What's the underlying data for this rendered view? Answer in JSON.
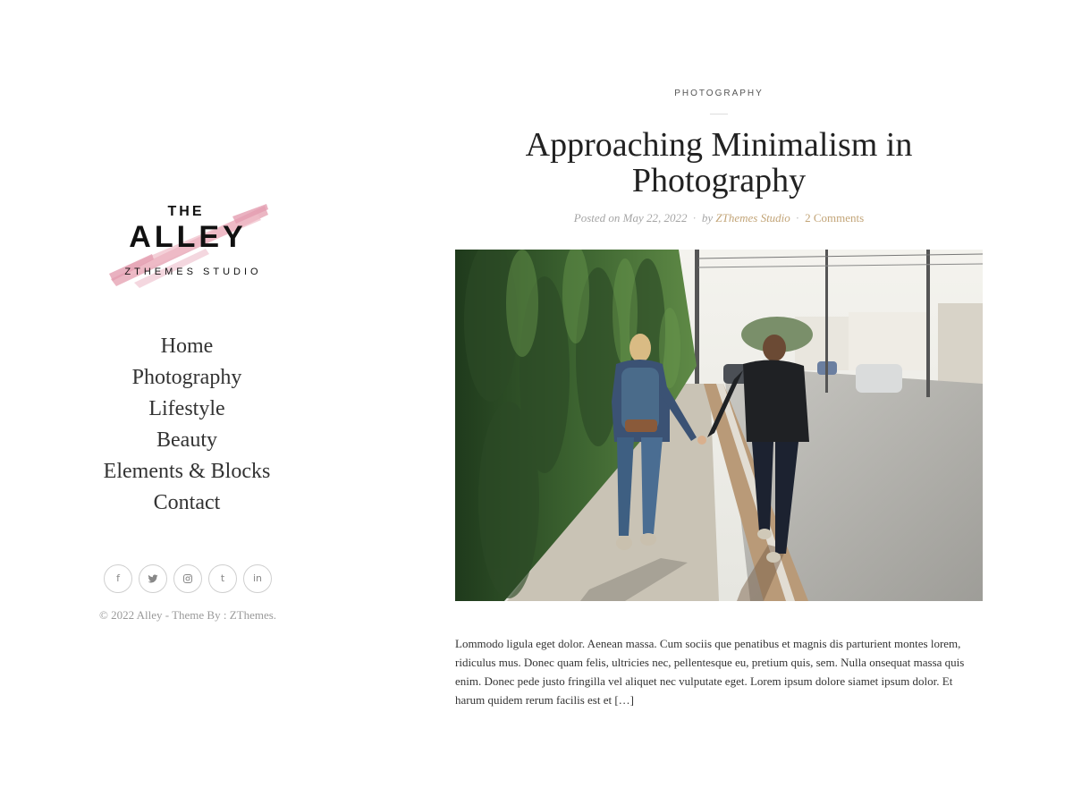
{
  "brand": {
    "top": "THE",
    "name": "ALLEY",
    "sub": "ZTHEMES STUDIO",
    "accent_color": "#e8a9b8"
  },
  "nav": {
    "items": [
      {
        "label": "Home"
      },
      {
        "label": "Photography"
      },
      {
        "label": "Lifestyle"
      },
      {
        "label": "Beauty"
      },
      {
        "label": "Elements & Blocks"
      },
      {
        "label": "Contact"
      }
    ]
  },
  "social": {
    "icons": [
      "facebook-icon",
      "twitter-icon",
      "instagram-icon",
      "tumblr-icon",
      "linkedin-icon"
    ],
    "glyphs": [
      "f",
      "",
      "",
      "t",
      "in"
    ]
  },
  "footer": {
    "copyright": "© 2022 Alley - Theme By : ZThemes."
  },
  "post": {
    "category": "PHOTOGRAPHY",
    "title": "Approaching Minimalism in Photography",
    "meta": {
      "posted_prefix": "Posted on",
      "date": "May 22, 2022",
      "sep": "·",
      "by_prefix": "by",
      "author": "ZThemes Studio",
      "comments": "2 Comments"
    },
    "excerpt": "Lommodo ligula eget dolor. Aenean massa. Cum sociis que penatibus et magnis dis parturient montes lorem, ridiculus mus. Donec quam felis, ultricies nec, pellentesque eu, pretium quis, sem. Nulla onsequat massa quis enim. Donec pede justo fringilla vel aliquet nec vulputate eget. Lorem ipsum dolore siamet ipsum dolor. Et harum quidem rerum facilis est et […]"
  },
  "colors": {
    "link_gold": "#c2a477",
    "muted": "#a5a5a5"
  }
}
